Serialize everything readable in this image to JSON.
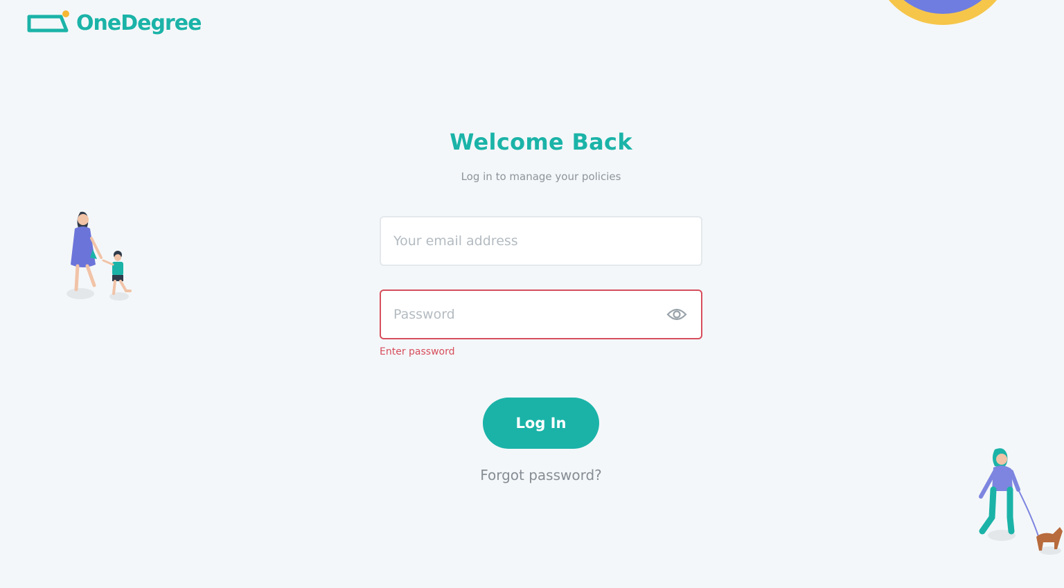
{
  "brand": {
    "name": "OneDegree",
    "primary_color": "#1bb3a8",
    "accent_color": "#f7b733"
  },
  "header": {
    "title": "Welcome Back",
    "subtitle": "Log in to manage your policies"
  },
  "form": {
    "email": {
      "placeholder": "Your email address",
      "value": ""
    },
    "password": {
      "placeholder": "Password",
      "value": "",
      "toggle_icon": "eye-icon",
      "error": "Enter password",
      "error_color": "#d64d5c"
    },
    "login_label": "Log In",
    "forgot_label": "Forgot password?"
  },
  "illustrations": {
    "top_right": "decorative-circle",
    "left": "mother-and-child-walking",
    "right": "woman-walking-dog"
  }
}
